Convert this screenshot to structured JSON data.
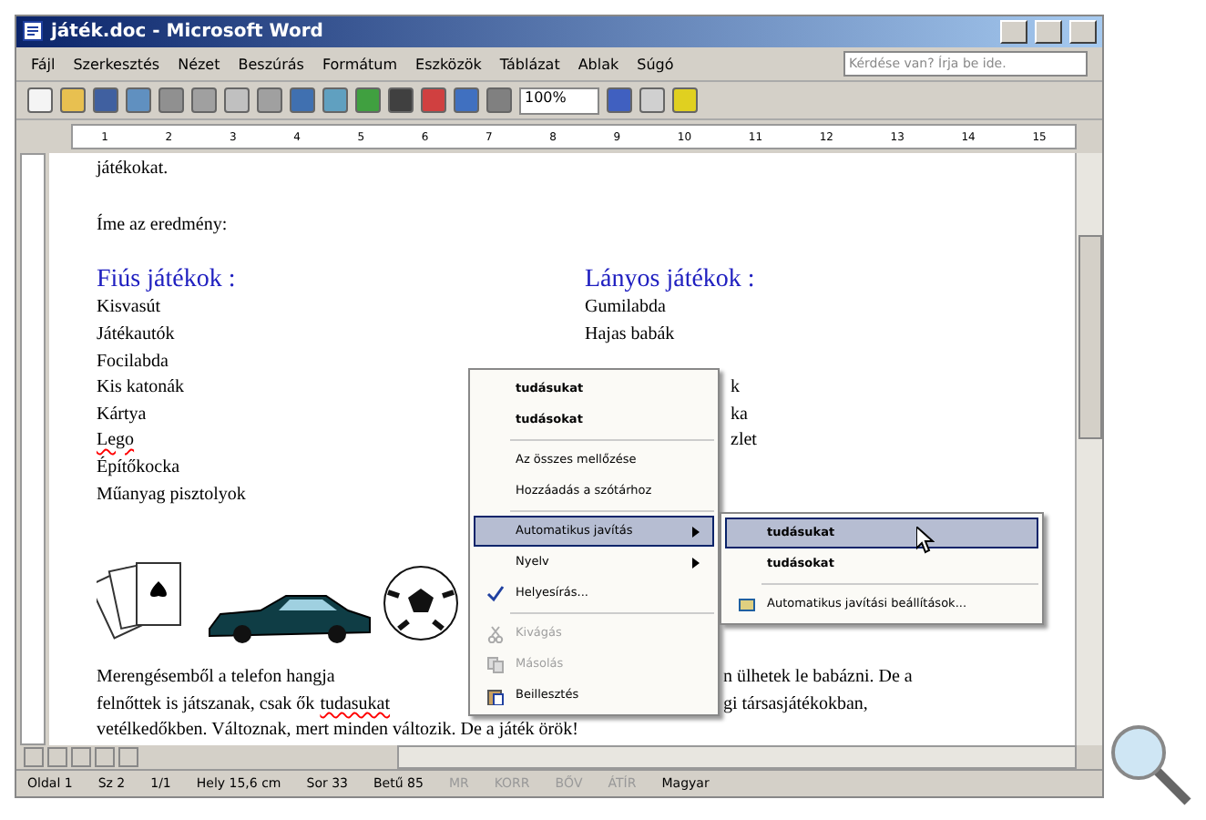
{
  "window": {
    "title": "játék.doc - Microsoft Word"
  },
  "menu_bar": [
    "Fájl",
    "Szerkesztés",
    "Nézet",
    "Beszúrás",
    "Formátum",
    "Eszközök",
    "Táblázat",
    "Ablak",
    "Súgó"
  ],
  "help_box": {
    "placeholder": "Kérdése van? Írja be ide."
  },
  "toolbar": {
    "zoom": "100%"
  },
  "ruler": [
    "1",
    "2",
    "3",
    "4",
    "5",
    "6",
    "7",
    "8",
    "9",
    "10",
    "11",
    "12",
    "13",
    "14",
    "15"
  ],
  "document": {
    "top_line": "játékokat.",
    "intro": "Íme az eredmény:",
    "columns": [
      {
        "heading": "Fiús játékok :",
        "items": [
          {
            "text": "Kisvasút",
            "misspelled": false
          },
          {
            "text": "Játékautók",
            "misspelled": false
          },
          {
            "text": "Focilabda",
            "misspelled": false
          },
          {
            "text": "Kis katonák",
            "misspelled": false
          },
          {
            "text": "Kártya",
            "misspelled": false
          },
          {
            "text": "Lego",
            "misspelled": true
          },
          {
            "text": "Építőkocka",
            "misspelled": false
          },
          {
            "text": "Műanyag pisztolyok",
            "misspelled": false
          }
        ]
      },
      {
        "heading": "Lányos játékok :",
        "items": [
          {
            "text": "Gumilabda",
            "misspelled": false
          },
          {
            "text": "Hajas babák",
            "misspelled": false
          }
        ],
        "fragments": [
          "k",
          "ka",
          "zlet"
        ]
      }
    ],
    "paragraph": [
      {
        "left": "Merengésemből a telefon hangja",
        "right": "n ülhetek le babázni. De a"
      },
      {
        "left": "felnőttek is játszanak, csak ők",
        "misspelled": "tudasukat",
        "right": "gi társasjátékokban,"
      },
      {
        "left": "vetélkedőkben. Változnak, mert minden változik. De a játék örök!"
      }
    ]
  },
  "context_menu": [
    {
      "kind": "suggestion",
      "label": "tudásukat",
      "selected": false,
      "disabled": false
    },
    {
      "kind": "suggestion",
      "label": "tudásokat",
      "selected": false,
      "disabled": false
    },
    {
      "kind": "separator"
    },
    {
      "kind": "item",
      "label": "Az összes mellőzése",
      "selected": false,
      "disabled": false
    },
    {
      "kind": "item",
      "label": "Hozzáadás a szótárhoz",
      "selected": false,
      "disabled": false
    },
    {
      "kind": "separator"
    },
    {
      "kind": "submenu",
      "label": "Automatikus javítás",
      "selected": true,
      "disabled": false
    },
    {
      "kind": "submenu",
      "label": "Nyelv",
      "selected": false,
      "disabled": false
    },
    {
      "kind": "item",
      "label": "Helyesírás...",
      "selected": false,
      "disabled": false
    },
    {
      "kind": "separator"
    },
    {
      "kind": "item",
      "label": "Kivágás",
      "selected": false,
      "disabled": true
    },
    {
      "kind": "item",
      "label": "Másolás",
      "selected": false,
      "disabled": true
    },
    {
      "kind": "item",
      "label": "Beillesztés",
      "selected": false,
      "disabled": false
    }
  ],
  "submenu": [
    {
      "kind": "suggestion",
      "label": "tudásukat",
      "selected": true
    },
    {
      "kind": "suggestion",
      "label": "tudásokat",
      "selected": false
    },
    {
      "kind": "separator"
    },
    {
      "kind": "item",
      "label": "Automatikus javítási beállítások...",
      "selected": false
    }
  ],
  "status_bar": [
    "Oldal 1",
    "Sz 2",
    "1/1",
    "Hely 15,6 cm",
    "Sor 33",
    "Betű 85"
  ],
  "modes": [
    {
      "label": "MR",
      "on": false
    },
    {
      "label": "KORR",
      "on": false
    },
    {
      "label": "BŐV",
      "on": false
    },
    {
      "label": "ÁTÍR",
      "on": false
    }
  ],
  "language": "Magyar"
}
